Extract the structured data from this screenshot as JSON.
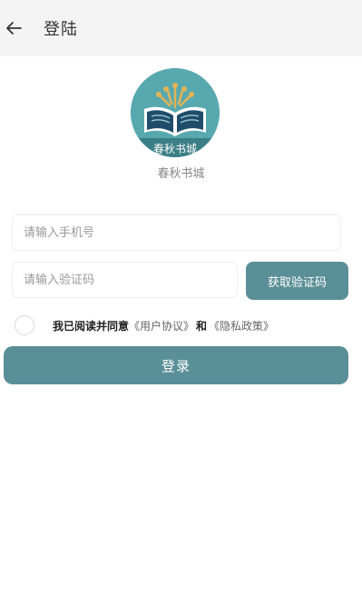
{
  "header": {
    "back_icon": "arrow-left-icon",
    "title": "登陆"
  },
  "logo": {
    "icon": "open-book-icon",
    "banner_text": "春秋书城",
    "caption": "春秋书城"
  },
  "form": {
    "phone_placeholder": "请输入手机号",
    "code_placeholder": "请输入验证码",
    "code_button": "获取验证码"
  },
  "agreement": {
    "prefix": "我已阅读并同意",
    "user_agreement": "《用户协议》",
    "and": "和",
    "privacy_policy": "《隐私政策》"
  },
  "login_button": "登录",
  "colors": {
    "accent": "#5a8f97",
    "header_bg": "#f4f4f4"
  }
}
